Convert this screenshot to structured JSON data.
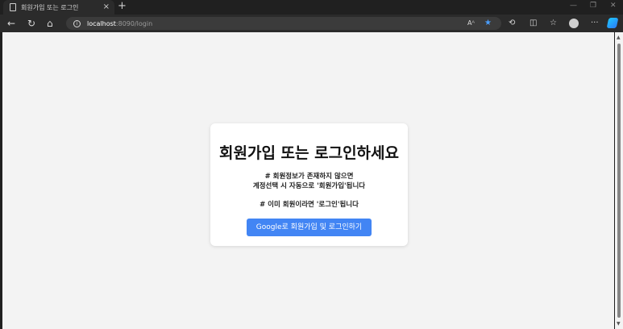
{
  "browser": {
    "tab_title": "회원가입 또는 로그인",
    "tab_close": "×",
    "new_tab": "+",
    "url_host": "localhost",
    "url_rest": ":8090/login",
    "icons": [
      "page-icon",
      "close-icon",
      "plus-icon",
      "back-arrow-icon",
      "refresh-icon",
      "home-icon",
      "info-icon",
      "read-aloud-icon",
      "favorite-star-icon",
      "extensions-icon",
      "split-screen-icon",
      "collections-icon",
      "profile-avatar-icon",
      "more-icon",
      "copilot-icon"
    ],
    "colors": {
      "star": "#4a9eff",
      "frame": "#202020",
      "toolbar": "#2b2b2b"
    }
  },
  "card": {
    "heading": "회원가입 또는 로그인하세요",
    "info_line1": "# 회원정보가 존재하지 않으면",
    "info_line2": "계정선택 시 자동으로 '회원가입'됩니다",
    "info_line3": "# 이미 회원이라면 '로그인'됩니다",
    "button_label": "Google로 회원가입 및 로그인하기",
    "colors": {
      "button": "#4285f4",
      "background": "#f3f3f3"
    }
  }
}
